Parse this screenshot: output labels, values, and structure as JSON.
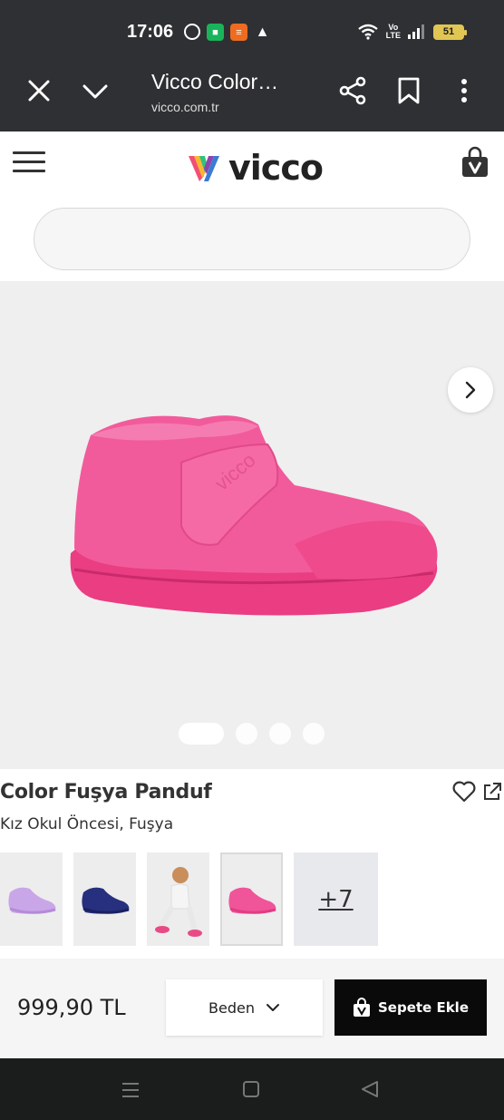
{
  "status": {
    "time": "17:06",
    "battery": "51",
    "network": "Vo LTE",
    "apps": [
      "whatsapp-icon",
      "messages-icon",
      "orange-app-icon",
      "a-icon"
    ]
  },
  "browser": {
    "title": "Vicco Color…",
    "url": "vicco.com.tr"
  },
  "site": {
    "logo_text": "vicco",
    "search_placeholder": ""
  },
  "product": {
    "title": "Color Fuşya Panduf",
    "subtitle": "Kız Okul Öncesi, Fuşya",
    "more_variants": "+7",
    "gallery_slides": 4,
    "active_slide": 1
  },
  "buy": {
    "price": "999,90 TL",
    "size_label": "Beden",
    "add_to_cart_label": "Sepete Ekle"
  },
  "colors": {
    "brand": "#2f3033",
    "shoe": "#ef4f8e",
    "cta": "#0a0a0a"
  }
}
